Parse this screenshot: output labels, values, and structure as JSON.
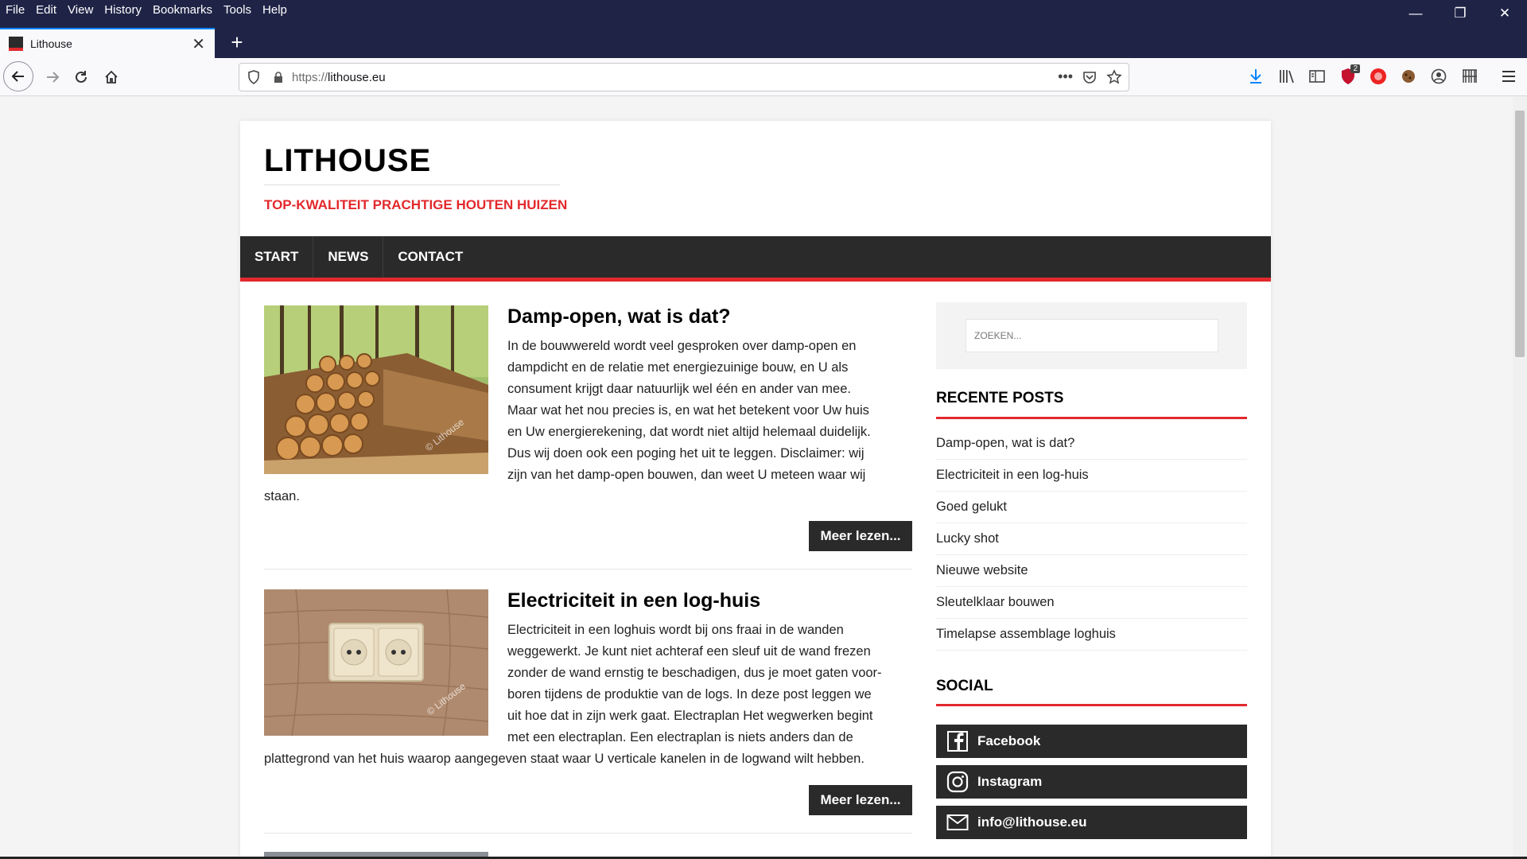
{
  "menu": [
    "File",
    "Edit",
    "View",
    "History",
    "Bookmarks",
    "Tools",
    "Help"
  ],
  "tab": {
    "title": "Lithouse",
    "close": "✕"
  },
  "newtab": "+",
  "url": {
    "scheme": "https://",
    "host": "lithouse.eu"
  },
  "downloads_badge": "2",
  "site": {
    "title": "LITHOUSE",
    "tagline": "TOP-KWALITEIT PRACHTIGE HOUTEN HUIZEN",
    "nav": [
      "START",
      "NEWS",
      "CONTACT"
    ]
  },
  "posts": [
    {
      "title": "Damp-open, wat is dat?",
      "lines": [
        "In de bouwwereld wordt veel gesproken over damp-open en",
        "dampdicht en de relatie met energiezuinige bouw, en U als",
        "consument krijgt daar natuurlijk wel één en ander van mee.",
        "Maar wat het nou precies is, en wat het betekent voor Uw huis",
        "en Uw energierekening, dat wordt niet altijd helemaal duidelijk.",
        "Dus wij doen ook een poging het uit te leggen. Disclaimer: wij",
        "zijn van het damp-open bouwen, dan weet U meteen waar wij"
      ],
      "tail": "staan.",
      "more": "Meer lezen...",
      "watermark": "© Lithouse"
    },
    {
      "title": "Electriciteit in een log-huis",
      "lines": [
        "Electriciteit in een loghuis wordt bij ons fraai in de wanden",
        "weggewerkt. Je kunt niet achteraf een sleuf uit de wand frezen",
        "zonder de wand ernstig te beschadigen, dus je moet gaten voor-",
        "boren tijdens de produktie van de logs. In deze post leggen we",
        "uit hoe dat in zijn werk gaat. Electraplan Het wegwerken begint",
        "met een electraplan. Een electraplan is niets anders dan de"
      ],
      "tail": "plattegrond van het huis waarop aangegeven staat waar U verticale kanelen in de logwand wilt hebben.",
      "more": "Meer lezen...",
      "watermark": "© Lithouse"
    }
  ],
  "sidebar": {
    "search_placeholder": "ZOEKEN...",
    "recent_title": "RECENTE POSTS",
    "recent": [
      "Damp-open, wat is dat?",
      "Electriciteit in een log-huis",
      "Goed gelukt",
      "Lucky shot",
      "Nieuwe website",
      "Sleutelklaar bouwen",
      "Timelapse assemblage loghuis"
    ],
    "social_title": "SOCIAL",
    "social": [
      "Facebook",
      "Instagram",
      "info@lithouse.eu"
    ]
  },
  "colors": {
    "accent": "#e2292d",
    "dark": "#2a2a2a",
    "titlebar": "#1f2447"
  }
}
